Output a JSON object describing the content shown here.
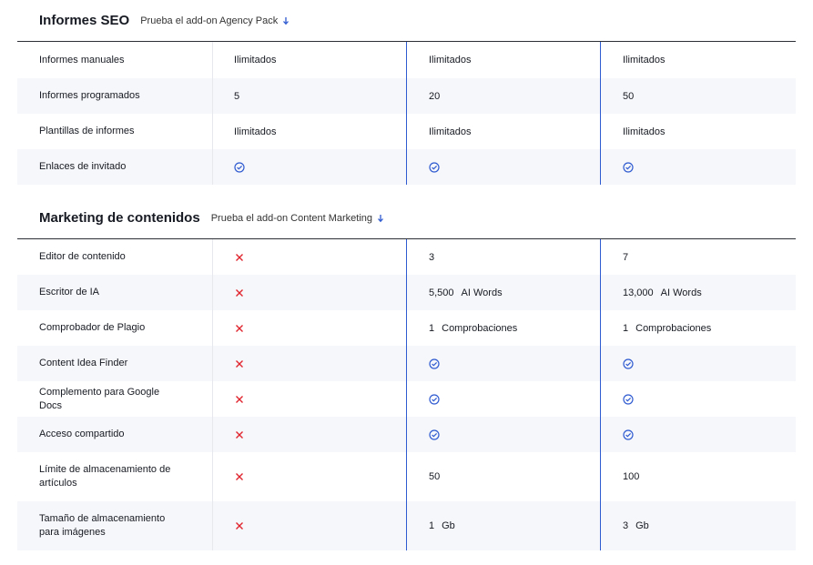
{
  "seo": {
    "title": "Informes SEO",
    "addon_link": "Prueba el add-on Agency Pack",
    "rows": [
      {
        "feature": "Informes manuales",
        "v1": "Ilimitados",
        "v2": "Ilimitados",
        "v3": "Ilimitados"
      },
      {
        "feature": "Informes programados",
        "v1": "5",
        "v2": "20",
        "v3": "50"
      },
      {
        "feature": "Plantillas de informes",
        "v1": "Ilimitados",
        "v2": "Ilimitados",
        "v3": "Ilimitados"
      },
      {
        "feature": "Enlaces de invitado"
      }
    ]
  },
  "content": {
    "title": "Marketing de contenidos",
    "addon_link": "Prueba el add-on Content Marketing",
    "rows": [
      {
        "feature": "Editor de contenido",
        "v2": "3",
        "v3": "7"
      },
      {
        "feature": "Escritor de IA",
        "v2a": "5,500",
        "v2b": "AI Words",
        "v3a": "13,000",
        "v3b": "AI Words"
      },
      {
        "feature": "Comprobador de Plagio",
        "v2a": "1",
        "v2b": "Comprobaciones",
        "v3a": "1",
        "v3b": "Comprobaciones"
      },
      {
        "feature": "Content Idea Finder"
      },
      {
        "feature": "Complemento para Google Docs"
      },
      {
        "feature": "Acceso compartido"
      },
      {
        "feature": "Límite de almacenamiento de artículos",
        "v2": "50",
        "v3": "100"
      },
      {
        "feature": "Tamaño de almacenamiento para imágenes",
        "v2a": "1",
        "v2b": "Gb",
        "v3a": "3",
        "v3b": "Gb"
      }
    ]
  },
  "icons": {
    "check": "check-circle-icon",
    "cross": "cross-icon",
    "arrow": "arrow-down-icon"
  },
  "colors": {
    "check": "#2f5bd1",
    "cross": "#e0242d",
    "divider": "#2f5bd1"
  }
}
